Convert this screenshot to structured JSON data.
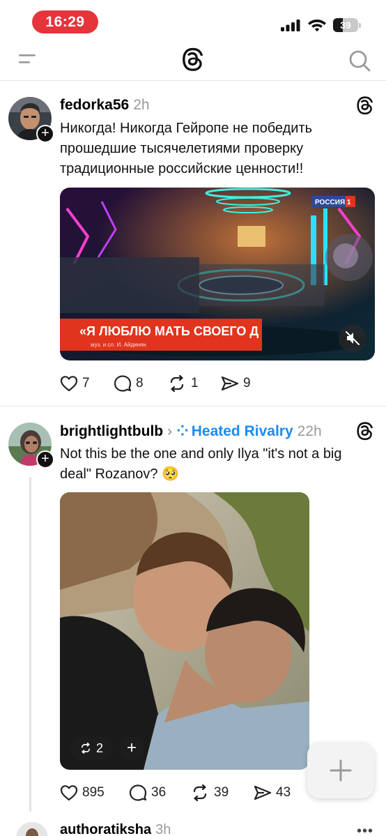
{
  "status_bar": {
    "time": "16:29",
    "battery": "39",
    "battery_level": 0.39
  },
  "header": {
    "menu_icon": "menu-icon",
    "logo_icon": "threads-logo-icon",
    "search_icon": "search-icon"
  },
  "posts": [
    {
      "username": "fedorka56",
      "time": "2h",
      "text": "Никогда! Никогда Гейропе не победить прошедшие тысячелетиями проверку традиционные российские ценности!!",
      "media": {
        "type": "video",
        "channel_badge": "РОССИЯ 1",
        "caption": "«Я ЛЮБЛЮ МАТЬ СВОЕГО Д",
        "caption_sub": "муз. и сл. И. Айдинян"
      },
      "likes": "7",
      "replies": "8",
      "reposts": "1",
      "shares": "9"
    },
    {
      "username": "brightlightbulb",
      "community": "Heated Rivalry",
      "time": "22h",
      "text": "Not this be the one and only Ilya \"it's not a big deal\" Rozanov? 🥺",
      "media": {
        "type": "image",
        "repost_count": "2"
      },
      "likes": "895",
      "replies": "36",
      "reposts": "39",
      "shares": "43"
    },
    {
      "username": "authoratiksha",
      "time": "3h"
    }
  ],
  "fab": {
    "icon": "plus-icon"
  }
}
